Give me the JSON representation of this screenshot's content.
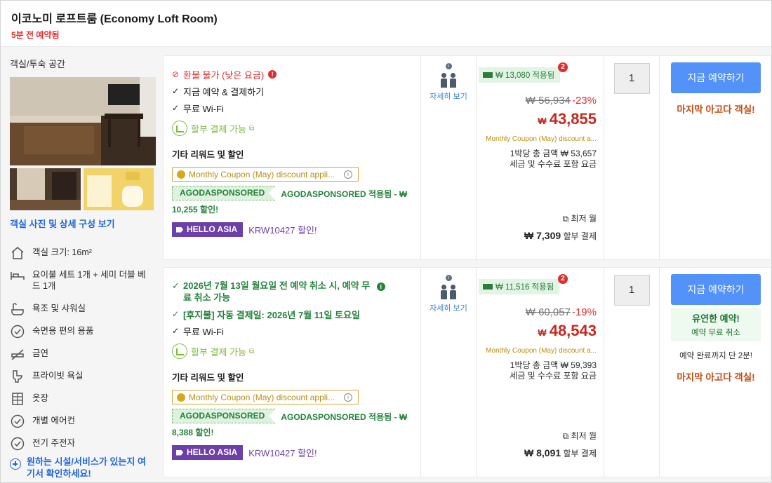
{
  "header": {
    "title": "이코노미 로프트룸 (Economy Loft Room)",
    "booked": "5분 전 예약됨"
  },
  "left": {
    "section_title": "객실/투숙 공간",
    "photos_link": "객실 사진 및 상세 구성 보기",
    "amenities": [
      {
        "label": "객실 크기: 16m²",
        "icon": "home-icon"
      },
      {
        "label": "요이불 세트 1개 + 세미 더블 베드 1개",
        "icon": "bed-icon"
      },
      {
        "label": "욕조 및 샤워실",
        "icon": "bath-icon"
      },
      {
        "label": "숙면용 편의 용품",
        "icon": "check-circle-icon"
      },
      {
        "label": "금연",
        "icon": "no-smoking-icon"
      },
      {
        "label": "프라이빗 욕실",
        "icon": "toilet-icon"
      },
      {
        "label": "옷장",
        "icon": "wardrobe-icon"
      },
      {
        "label": "개별 에어컨",
        "icon": "check-circle-icon"
      },
      {
        "label": "전기 주전자",
        "icon": "check-circle-icon"
      }
    ],
    "more_link": "원하는 시설/서비스가 있는지 여기서 확인하세요!"
  },
  "offers": [
    {
      "policy": "환불 불가 (낮은 요금)",
      "features": [
        "지금 예약 & 결제하기",
        "무료 Wi-Fi"
      ],
      "installment": "할부 결제 가능",
      "rewards_title": "기타 리워드 및 할인",
      "coupon": "Monthly Coupon (May) discount appli...",
      "sponsor_badge": "AGODASPONSORED",
      "sponsor_text": "AGODASPONSORED 적용됨 - ₩",
      "sponsor_text2": "10,255 할인!",
      "promo_badge": "HELLO ASIA",
      "promo_text": "KRW10427 할인!",
      "occupancy_link": "자세히 보기",
      "applied": "₩ 13,080 적용됨",
      "applied_count": "2",
      "original_price": "₩ 56,934",
      "discount": "-23%",
      "currency": "₩",
      "final_price": "43,855",
      "monthly_coupon": "Monthly Coupon (May) discount a...",
      "total_line1": "1박당 총 금액 ₩ 53,657",
      "total_line2": "세금 및 수수료 포함 요금",
      "monthly_label": "최저 월",
      "monthly_amount": "₩ 7,309",
      "monthly_suffix": "할부 결제",
      "quantity": "1",
      "book_label": "지금 예약하기",
      "last_room": "마지막 아고다 객실!"
    },
    {
      "policy_line1": "2026년 7월 13일 월요일 전 예약 취소 시, 예약 무",
      "policy_line2": "료 취소 가능",
      "postpay_line": "[후지불] 자동 결제일: 2026년 7월 11일 토요일",
      "features": [
        "무료 Wi-Fi"
      ],
      "installment": "할부 결제 가능",
      "rewards_title": "기타 리워드 및 할인",
      "coupon": "Monthly Coupon (May) discount appli...",
      "sponsor_badge": "AGODASPONSORED",
      "sponsor_text": "AGODASPONSORED 적용됨 - ₩",
      "sponsor_text2": "8,388 할인!",
      "promo_badge": "HELLO ASIA",
      "promo_text": "KRW10427 할인!",
      "occupancy_link": "자세히 보기",
      "applied": "₩ 11,516 적용됨",
      "applied_count": "2",
      "original_price": "₩ 60,057",
      "discount": "-19%",
      "currency": "₩",
      "final_price": "48,543",
      "monthly_coupon": "Monthly Coupon (May) discount a...",
      "total_line1": "1박당 총 금액 ₩ 59,393",
      "total_line2": "세금 및 수수료 포함 요금",
      "monthly_label": "최저 월",
      "monthly_amount": "₩ 8,091",
      "monthly_suffix": "할부 결제",
      "quantity": "1",
      "book_label": "지금 예약하기",
      "flex_title": "유연한 예약!",
      "flex_sub": "예약 무료 취소",
      "remain": "예약 완료까지 단 2분!",
      "last_room": "마지막 아고다 객실!"
    }
  ]
}
